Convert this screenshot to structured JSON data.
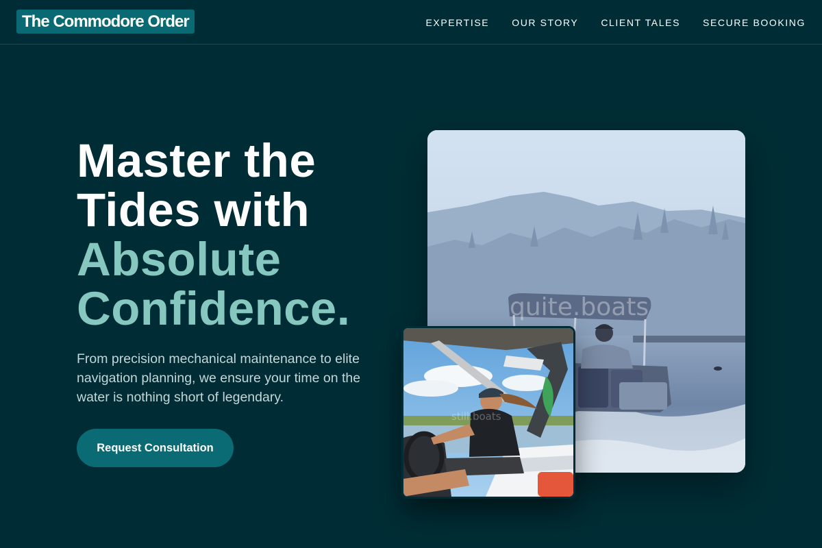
{
  "brand": {
    "name": "The Commodore Order"
  },
  "nav": [
    {
      "label": "EXPERTISE"
    },
    {
      "label": "OUR STORY"
    },
    {
      "label": "CLIENT TALES"
    },
    {
      "label": "SECURE BOOKING"
    }
  ],
  "hero": {
    "headline_line1": "Master the",
    "headline_line2": "Tides with",
    "headline_line3": "Absolute",
    "headline_line4": "Confidence.",
    "lede": "From precision mechanical maintenance to elite navigation planning, we ensure your time on the water is nothing short of legendary.",
    "cta_label": "Request Consultation"
  },
  "images": {
    "main_watermark": "quite.boats",
    "inset_watermark": "still.boats"
  },
  "colors": {
    "background": "#002d35",
    "accent_text": "#86c7c0",
    "button": "#0b6b75",
    "logo_bg": "#0a6a74"
  }
}
